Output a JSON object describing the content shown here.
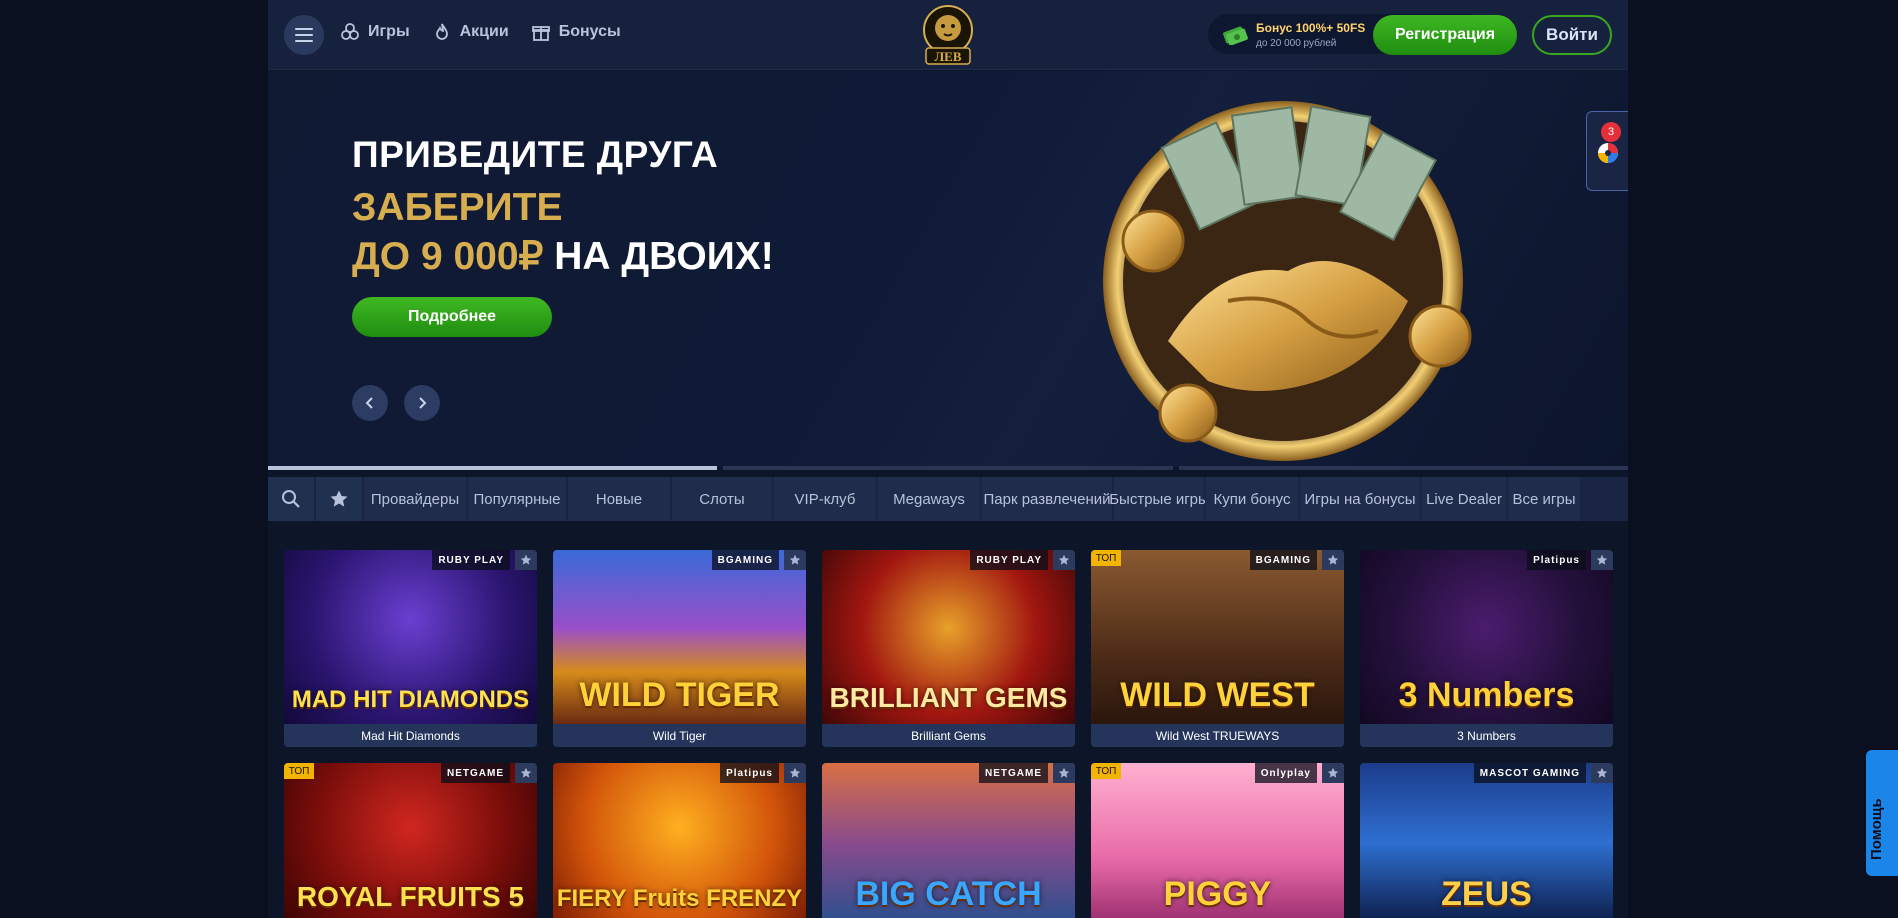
{
  "header": {
    "nav": [
      {
        "label": "Игры",
        "icon": "games-icon"
      },
      {
        "label": "Акции",
        "icon": "fire-icon"
      },
      {
        "label": "Бонусы",
        "icon": "gift-icon"
      }
    ],
    "logo_text": "ЛЕВ",
    "bonus_title": "Бонус 100%+ 50FS",
    "bonus_sub": "до 20 000 рублей",
    "register_label": "Регистрация",
    "login_label": "Войти"
  },
  "banner": {
    "line1": "ПРИВЕДИТЕ ДРУГА",
    "line2": "ЗАБЕРИТЕ",
    "line3_gold": "ДО 9 000₽",
    "line3_white": "НА ДВОИХ!",
    "button_label": "Подробнее",
    "slides_total": 3,
    "slide_active": 1
  },
  "side_widget": {
    "badge_count": "3"
  },
  "categories": [
    "Провайдеры",
    "Популярные",
    "Новые",
    "Слоты",
    "VIP-клуб",
    "Megaways",
    "Парк развлечений",
    "Быстрые игры",
    "Купи бонус",
    "Игры на бонусы",
    "Live Dealer",
    "Все игры"
  ],
  "games_row1": [
    {
      "name": "Mad Hit Diamonds",
      "provider": "RUBY PLAY",
      "art": "MAD HIT DIAMONDS",
      "top": false
    },
    {
      "name": "Wild Tiger",
      "provider": "BGAMING",
      "art": "WILD TIGER",
      "top": false
    },
    {
      "name": "Brilliant Gems",
      "provider": "RUBY PLAY",
      "art": "BRILLIANT GEMS",
      "top": false
    },
    {
      "name": "Wild West TRUEWAYS",
      "provider": "BGAMING",
      "art": "WILD WEST",
      "top": true
    },
    {
      "name": "3 Numbers",
      "provider": "Platipus",
      "art": "3 Numbers",
      "top": false
    }
  ],
  "games_row2": [
    {
      "provider": "NETGAME",
      "art": "ROYAL FRUITS 5",
      "top": true
    },
    {
      "provider": "Platipus",
      "art": "FIERY Fruits FRENZY",
      "top": false
    },
    {
      "provider": "NETGAME",
      "art": "BIG CATCH",
      "top": false
    },
    {
      "provider": "Onlyplay",
      "art": "PIGGY",
      "top": true
    },
    {
      "provider": "MASCOT GAMING",
      "art": "ZEUS",
      "top": false
    }
  ],
  "top_badge_label": "ТОП",
  "help_label": "Помощь",
  "colors": {
    "accent_green": "#2fa516",
    "gold": "#d6ad4f",
    "bg": "#0d1528"
  }
}
